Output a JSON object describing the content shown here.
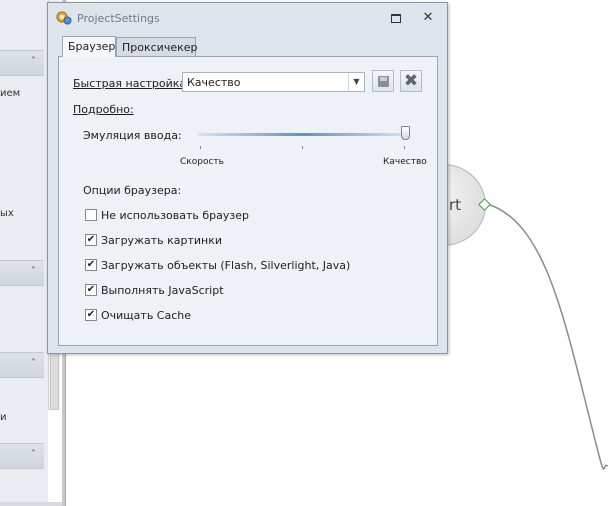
{
  "background": {
    "sidebar_snippets": [
      "ием",
      "ых",
      "и"
    ],
    "node_label": "rt"
  },
  "dialog": {
    "title": "ProjectSettings",
    "tabs": [
      {
        "label": "Браузер",
        "active": true
      },
      {
        "label": "Проксичекер",
        "active": false
      }
    ],
    "quick_setup": {
      "label": "Быстрая настройка:",
      "value": "Качество"
    },
    "details_label": "Подробно:",
    "emulation": {
      "label": "Эмуляция ввода:",
      "min_label": "Скорость",
      "max_label": "Качество",
      "level": 1.0
    },
    "options": {
      "label": "Опции браузера:",
      "items": [
        {
          "label": "Не использовать браузер",
          "checked": false
        },
        {
          "label": "Загружать картинки",
          "checked": true
        },
        {
          "label": "Загружать объекты (Flash, Silverlight, Java)",
          "checked": true
        },
        {
          "label": "Выполнять JavaScript",
          "checked": true
        },
        {
          "label": "Очищать Cache",
          "checked": true
        }
      ]
    }
  },
  "icons": {
    "app": "settings-app-icon",
    "restore": "restore-icon",
    "close": "close-icon",
    "save": "save-disk-icon",
    "delete": "delete-x-icon",
    "dropdown": "chevron-down-icon"
  }
}
